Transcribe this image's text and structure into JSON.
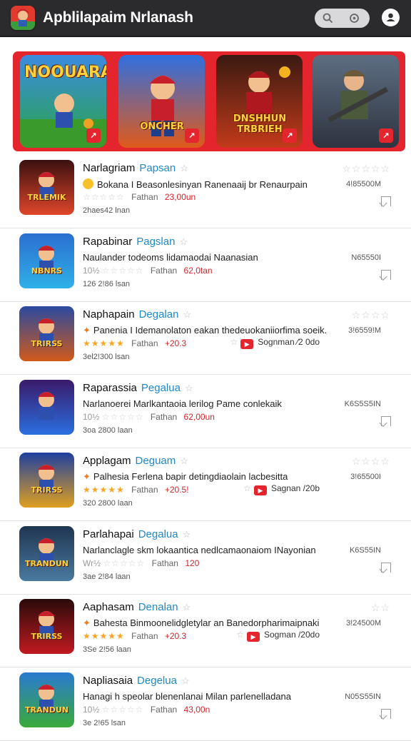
{
  "header": {
    "title": "Apblilapaim Nrlanash",
    "icons": [
      "app-logo-icon",
      "search-icon",
      "filter-icon",
      "profile-icon"
    ]
  },
  "featured": [
    {
      "caption": "NOOUARA",
      "badge": "↗"
    },
    {
      "caption": "ONCHER",
      "badge": "↗"
    },
    {
      "caption": "DNSHHUN TRBRIEH",
      "badge": "↗"
    },
    {
      "caption": "",
      "badge": "↗"
    }
  ],
  "list": [
    {
      "name": "Narlagriam",
      "dev": "Papsan",
      "desc": "Bokana I Beasonlesinyan Ranenaaij br Renaurpain",
      "rating_prefix": "",
      "stars": 0,
      "price": "23,00un",
      "extra": "",
      "size": "2haes42 lnan",
      "thumb_caption": "TRLEMIK",
      "right_num": "4!85500M",
      "right_stars": "☆☆☆☆☆"
    },
    {
      "name": "Rapabinar",
      "dev": "Pagslan",
      "desc": "Naulander todeoms lidamaodai Naanasian",
      "rating_prefix": "10½",
      "stars": 0,
      "price": "62,0tan",
      "extra": "",
      "size": "126 2!86 lsan",
      "thumb_caption": "NBNRS",
      "right_num": "N65550I",
      "right_stars": ""
    },
    {
      "name": "Naphapain",
      "dev": "Degalan",
      "desc": "Panenia I Idemanolaton eakan thedeuokaniiorfima soeik.",
      "rating_prefix": "",
      "stars": 5,
      "price": "+20.3",
      "extra": "Sognman ⁄2 0do",
      "size": "3el2!300 lsan",
      "thumb_caption": "TRIRSS",
      "right_num": "3!6559!M",
      "right_stars": "☆☆☆☆"
    },
    {
      "name": "Raparassia",
      "dev": "Pegalua",
      "desc": "Narlanoerei Marlkantaoia lerilog Pame conlekaik",
      "rating_prefix": "10½",
      "stars": 0,
      "price": "62,00un",
      "extra": "",
      "size": "3oa 2800 laan",
      "thumb_caption": "",
      "right_num": "K6S5S5IN",
      "right_stars": ""
    },
    {
      "name": "Applagam",
      "dev": "Deguam",
      "desc": "Palhesia Ferlena bapir detingdiaolain lacbesitta",
      "rating_prefix": "",
      "stars": 5,
      "price": "+20.5!",
      "extra": "Sagnan /20b",
      "size": "320 2800 laan",
      "thumb_caption": "TRIRSS",
      "right_num": "3!65500I",
      "right_stars": "☆☆☆☆"
    },
    {
      "name": "Parlahapai",
      "dev": "Degalua",
      "desc": "Narlanclagle skm lokaantica nedlcamaonaiom INayonian",
      "rating_prefix": "Wr½",
      "stars": 0,
      "price": "120",
      "extra": "",
      "size": "3ae 2!84 laan",
      "thumb_caption": "TRANDUN",
      "right_num": "K6S55IN",
      "right_stars": ""
    },
    {
      "name": "Aaphasam",
      "dev": "Denalan",
      "desc": "Bahesta Binmoonelidgletylar an Banedorpharimaipnaki",
      "rating_prefix": "",
      "stars": 5,
      "price": "+20.3",
      "extra": "Sogman /20do",
      "size": "3Se 2!56 laan",
      "thumb_caption": "TRIRSS",
      "right_num": "3!24500M",
      "right_stars": "☆☆"
    },
    {
      "name": "Napliasaia",
      "dev": "Degelua",
      "desc": "Hanagi h speolar blenenlanai Milan parlenelladana",
      "rating_prefix": "10½",
      "stars": 0,
      "price": "43,00n",
      "extra": "",
      "size": "3e 2!65 lsan",
      "thumb_caption": "TRANDUN",
      "right_num": "N05S55IN",
      "right_stars": ""
    }
  ]
}
